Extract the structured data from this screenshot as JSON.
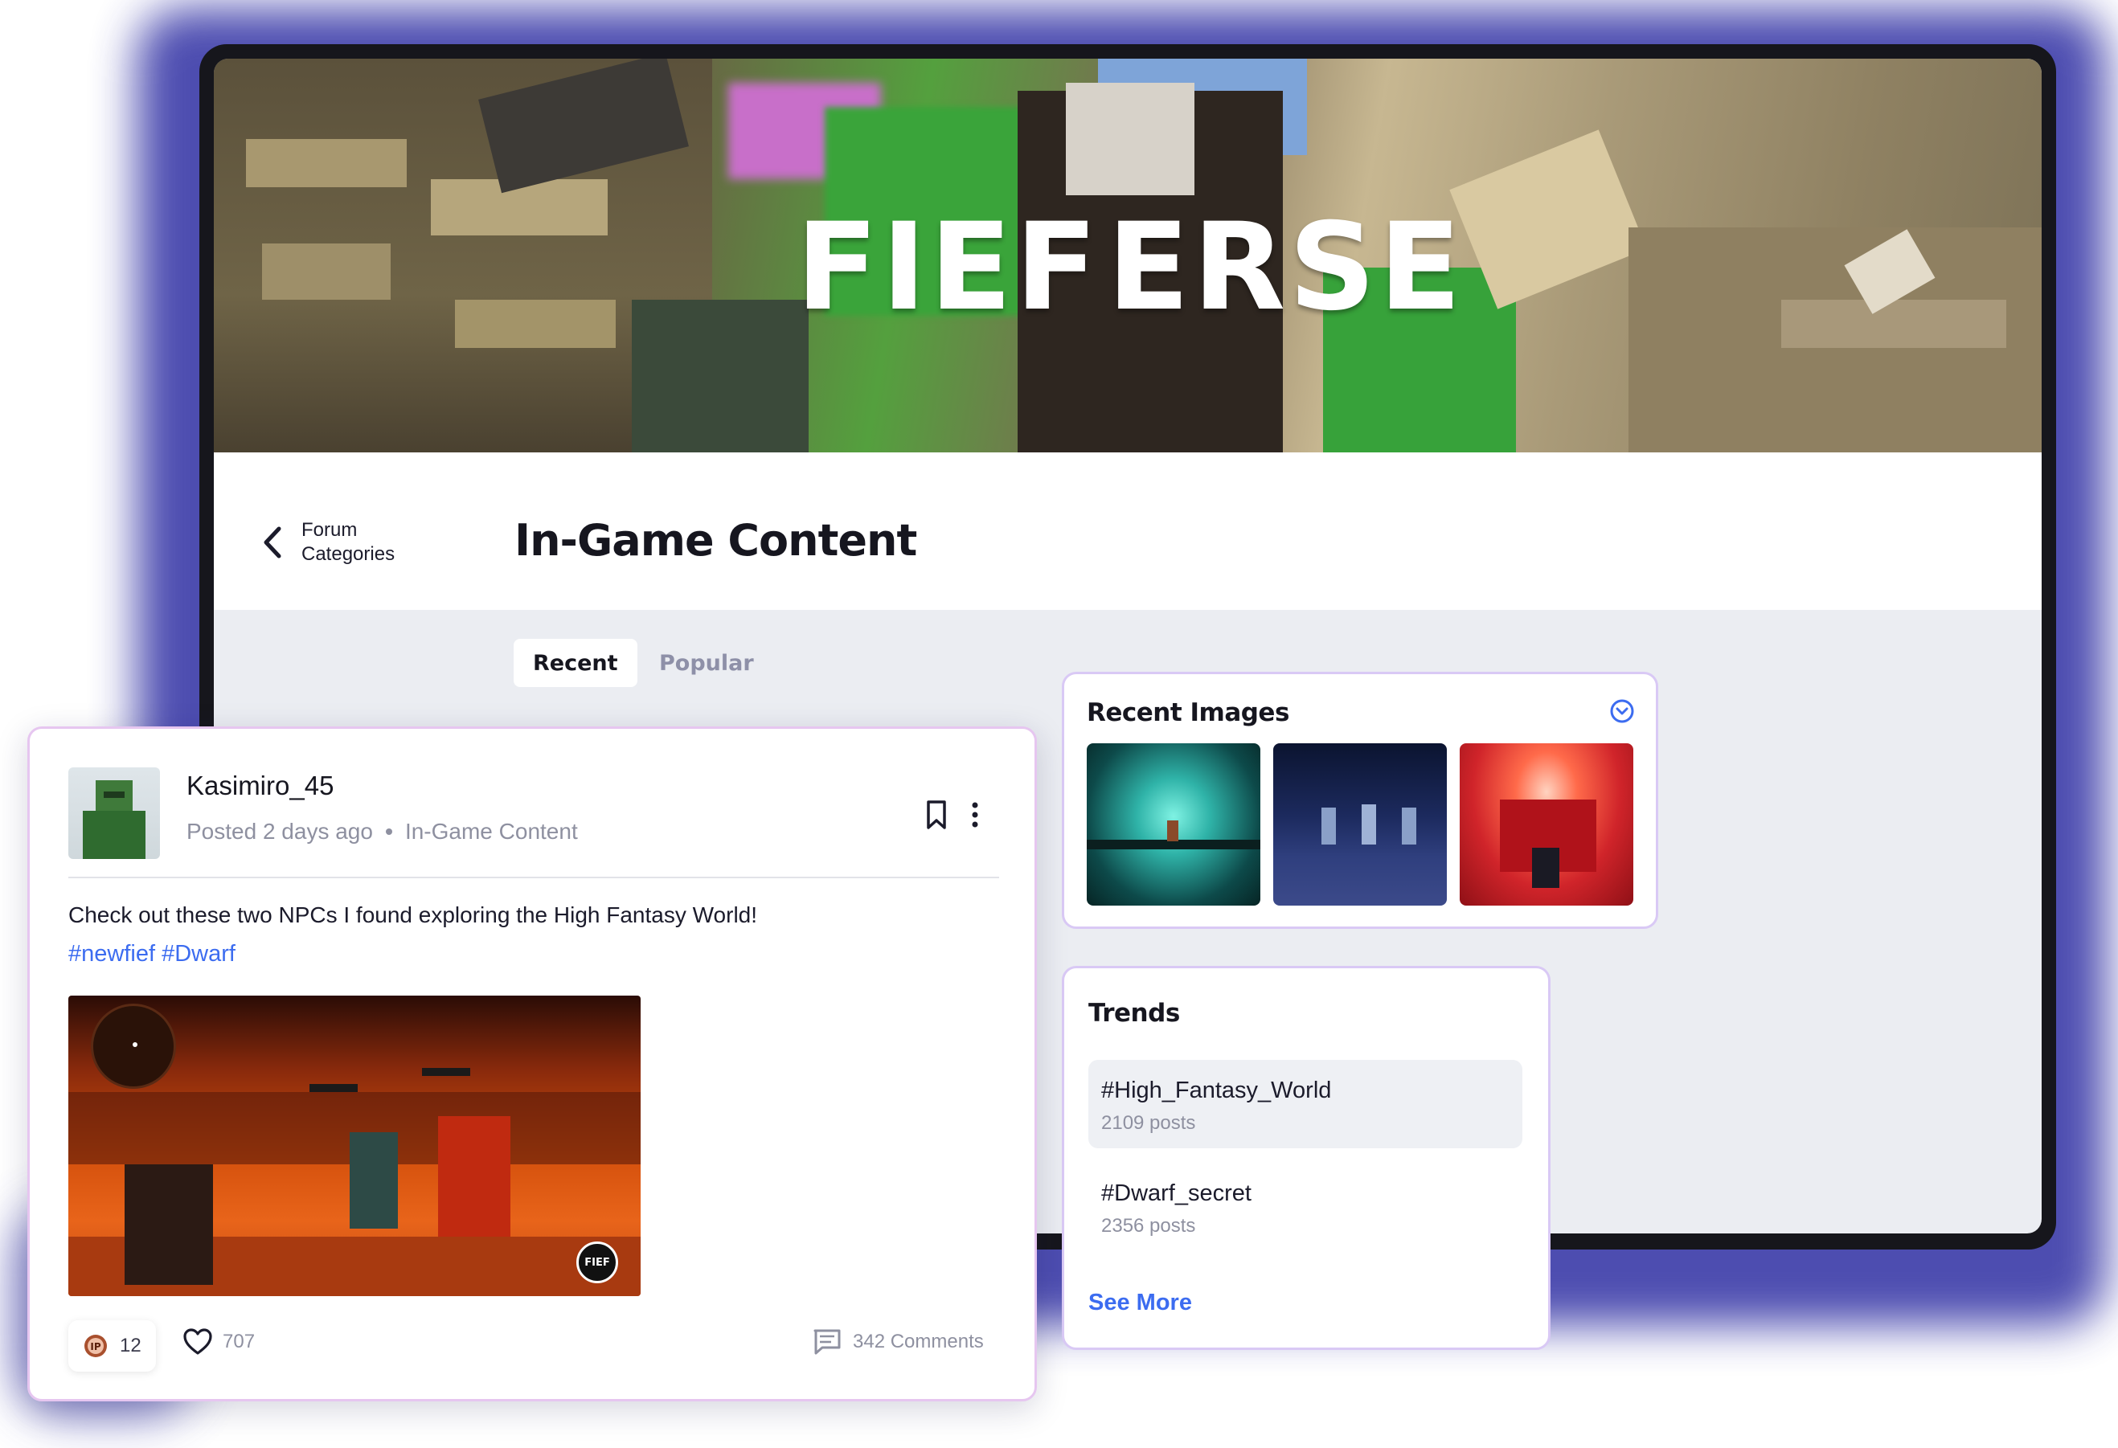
{
  "brand": {
    "logo_text_left": "FIEF",
    "logo_text_right": "ERSE",
    "colors": {
      "accent": "#3c6cf0",
      "frame": "#16161c",
      "glow": "#3a3aa8",
      "card_border": "#d9c9f5"
    }
  },
  "header": {
    "back_label_line1": "Forum",
    "back_label_line2": "Categories",
    "back_icon": "chevron-left-icon",
    "title": "In-Game Content"
  },
  "tabs": [
    {
      "label": "Recent",
      "active": true
    },
    {
      "label": "Popular",
      "active": false
    }
  ],
  "recent_images": {
    "title": "Recent Images",
    "toggle_icon": "chevron-down-circle-icon",
    "images": [
      "cave-scene",
      "night-knights-scene",
      "red-crab-scene"
    ]
  },
  "trends": {
    "title": "Trends",
    "items": [
      {
        "tag": "#High_Fantasy_World",
        "count": "2109 posts",
        "highlighted": true
      },
      {
        "tag": "#Dwarf_secret",
        "count": "2356 posts",
        "highlighted": false
      }
    ],
    "see_more": "See More"
  },
  "post": {
    "username": "Kasimiro_45",
    "posted": "Posted 2 days ago",
    "category": "In-Game Content",
    "text": "Check out these two NPCs I found exploring the High Fantasy World!",
    "hashtags": [
      "#newfief",
      "#Dwarf"
    ],
    "reaction_count": "12",
    "likes": "707",
    "comments": "342 Comments",
    "image_badge": "FIEF"
  }
}
